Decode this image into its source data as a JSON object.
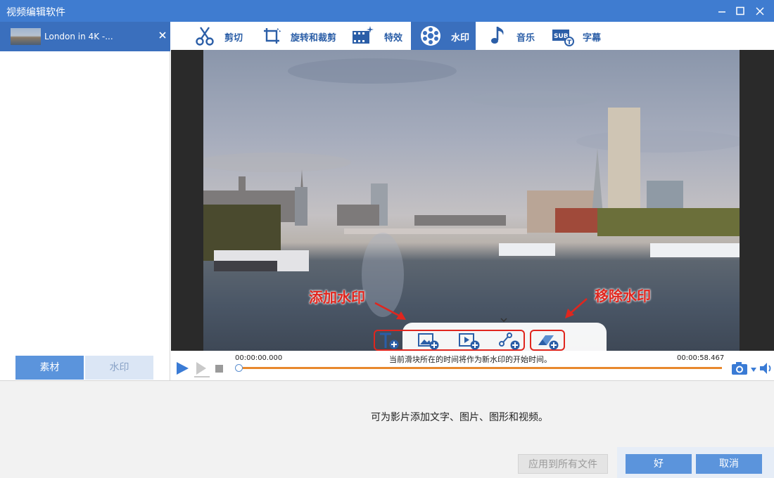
{
  "window": {
    "title": "视频编辑软件"
  },
  "file_list": {
    "items": [
      {
        "name": "London in 4K -..."
      }
    ]
  },
  "left_tabs": {
    "material": "素材",
    "watermark": "水印"
  },
  "tool_tabs": [
    {
      "label": "剪切",
      "icon": "scissors-icon"
    },
    {
      "label": "旋转和裁剪",
      "icon": "crop-rotate-icon"
    },
    {
      "label": "特效",
      "icon": "effects-film-icon"
    },
    {
      "label": "水印",
      "icon": "watermark-icon",
      "active": true
    },
    {
      "label": "音乐",
      "icon": "music-note-icon"
    },
    {
      "label": "字幕",
      "icon": "subtitle-icon"
    }
  ],
  "annotations": {
    "add_watermark": "添加水印",
    "remove_watermark": "移除水印"
  },
  "watermark_tools": [
    {
      "icon": "add-text-watermark-icon"
    },
    {
      "icon": "add-image-watermark-icon"
    },
    {
      "icon": "add-video-watermark-icon"
    },
    {
      "icon": "add-shape-watermark-icon"
    },
    {
      "icon": "remove-watermark-icon"
    }
  ],
  "timeline": {
    "start_time": "00:00:00.000",
    "end_time": "00:00:58.467",
    "hint": "当前滑块所在的时间将作为新水印的开始时间。",
    "progress": 0
  },
  "bottom": {
    "description": "可为影片添加文字、图片、图形和视频。",
    "apply_all": "应用到所有文件",
    "ok": "好",
    "cancel": "取消"
  },
  "colors": {
    "accent": "#3a6fbd",
    "titlebar": "#3f7cd0",
    "annotation": "#e0261e",
    "track": "#e8882d"
  }
}
